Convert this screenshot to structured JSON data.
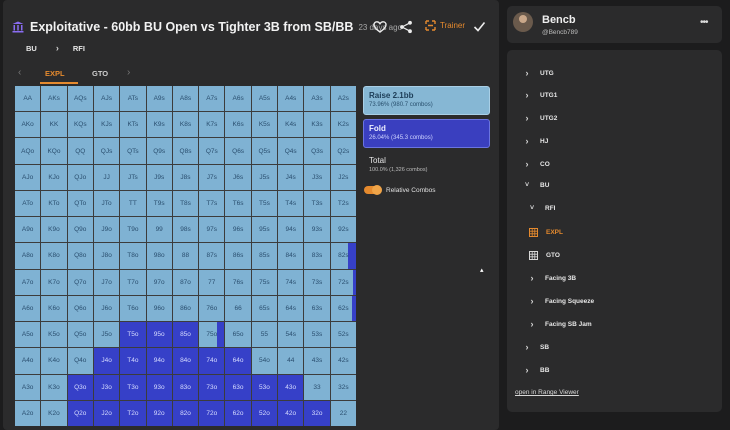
{
  "header": {
    "title": "Exploitative - 60bb BU Open vs Tighter 3B from SB/BB",
    "time_ago": "23 days ago",
    "trainer_label": "Trainer"
  },
  "breadcrumb": {
    "position": "BU",
    "action": "RFI"
  },
  "tabs": [
    {
      "label": "EXPL",
      "active": true
    },
    {
      "label": "GTO",
      "active": false
    }
  ],
  "grid": {
    "hands": [
      [
        "AA",
        "AKs",
        "AQs",
        "AJs",
        "ATs",
        "A9s",
        "A8s",
        "A7s",
        "A6s",
        "A5s",
        "A4s",
        "A3s",
        "A2s"
      ],
      [
        "AKo",
        "KK",
        "KQs",
        "KJs",
        "KTs",
        "K9s",
        "K8s",
        "K7s",
        "K6s",
        "K5s",
        "K4s",
        "K3s",
        "K2s"
      ],
      [
        "AQo",
        "KQo",
        "QQ",
        "QJs",
        "QTs",
        "Q9s",
        "Q8s",
        "Q7s",
        "Q6s",
        "Q5s",
        "Q4s",
        "Q3s",
        "Q2s"
      ],
      [
        "AJo",
        "KJo",
        "QJo",
        "JJ",
        "JTs",
        "J9s",
        "J8s",
        "J7s",
        "J6s",
        "J5s",
        "J4s",
        "J3s",
        "J2s"
      ],
      [
        "ATo",
        "KTo",
        "QTo",
        "JTo",
        "TT",
        "T9s",
        "T8s",
        "T7s",
        "T6s",
        "T5s",
        "T4s",
        "T3s",
        "T2s"
      ],
      [
        "A9o",
        "K9o",
        "Q9o",
        "J9o",
        "T9o",
        "99",
        "98s",
        "97s",
        "96s",
        "95s",
        "94s",
        "93s",
        "92s"
      ],
      [
        "A8o",
        "K8o",
        "Q8o",
        "J8o",
        "T8o",
        "98o",
        "88",
        "87s",
        "86s",
        "85s",
        "84s",
        "83s",
        "82s"
      ],
      [
        "A7o",
        "K7o",
        "Q7o",
        "J7o",
        "T7o",
        "97o",
        "87o",
        "77",
        "76s",
        "75s",
        "74s",
        "73s",
        "72s"
      ],
      [
        "A6o",
        "K6o",
        "Q6o",
        "J6o",
        "T6o",
        "96o",
        "86o",
        "76o",
        "66",
        "65s",
        "64s",
        "63s",
        "62s"
      ],
      [
        "A5o",
        "K5o",
        "Q5o",
        "J5o",
        "T5o",
        "95o",
        "85o",
        "75o",
        "65o",
        "55",
        "54s",
        "53s",
        "52s"
      ],
      [
        "A4o",
        "K4o",
        "Q4o",
        "J4o",
        "T4o",
        "94o",
        "84o",
        "74o",
        "64o",
        "54o",
        "44",
        "43s",
        "42s"
      ],
      [
        "A3o",
        "K3o",
        "Q3o",
        "J3o",
        "T3o",
        "93o",
        "83o",
        "73o",
        "63o",
        "53o",
        "43o",
        "33",
        "32s"
      ],
      [
        "A2o",
        "K2o",
        "Q2o",
        "J2o",
        "T2o",
        "92o",
        "82o",
        "72o",
        "62o",
        "52o",
        "42o",
        "32o",
        "22"
      ]
    ],
    "fold_freq": [
      [
        0,
        0,
        0,
        0,
        0,
        0,
        0,
        0,
        0,
        0,
        0,
        0,
        0
      ],
      [
        0,
        0,
        0,
        0,
        0,
        0,
        0,
        0,
        0,
        0,
        0,
        0,
        0
      ],
      [
        0,
        0,
        0,
        0,
        0,
        0,
        0,
        0,
        0,
        0,
        0,
        0,
        0
      ],
      [
        0,
        0,
        0,
        0,
        0,
        0,
        0,
        0,
        0,
        0,
        0,
        0,
        0
      ],
      [
        0,
        0,
        0,
        0,
        0,
        0,
        0,
        0,
        0,
        0,
        0,
        0,
        0
      ],
      [
        0,
        0,
        0,
        0,
        0,
        0,
        0,
        0,
        0,
        0,
        0,
        0,
        0
      ],
      [
        0,
        0,
        0,
        0,
        0,
        0,
        0,
        0,
        0,
        0,
        0,
        0,
        0.3
      ],
      [
        0,
        0,
        0,
        0,
        0,
        0,
        0,
        0,
        0,
        0,
        0,
        0,
        0.1
      ],
      [
        0,
        0,
        0,
        0,
        0,
        0,
        0,
        0,
        0,
        0,
        0,
        0,
        0.15
      ],
      [
        0,
        0,
        0,
        0,
        1,
        1,
        1,
        0.3,
        0,
        0,
        0,
        0,
        0
      ],
      [
        0,
        0,
        0,
        1,
        1,
        1,
        1,
        1,
        1,
        0,
        0,
        0,
        0
      ],
      [
        0,
        0,
        1,
        1,
        1,
        1,
        1,
        1,
        1,
        1,
        1,
        0,
        0
      ],
      [
        0,
        0,
        1,
        1,
        1,
        1,
        1,
        1,
        1,
        1,
        1,
        1,
        0
      ]
    ]
  },
  "actions": {
    "raise": {
      "name": "Raise 2.1bb",
      "detail": "73.96% (980.7 combos)"
    },
    "fold": {
      "name": "Fold",
      "detail": "26.04% (345.3 combos)"
    },
    "total": {
      "name": "Total",
      "detail": "100.0% (1,326 combos)"
    },
    "relative_combos_label": "Relative Combos"
  },
  "colors": {
    "raise": "#7fb2d3",
    "fold": "#3640c8",
    "accent": "#e58a2e"
  },
  "user": {
    "name": "Bencb",
    "handle": "@Bencb789"
  },
  "nav": {
    "items": [
      {
        "label": "UTG",
        "depth": 0,
        "expanded": false
      },
      {
        "label": "UTG1",
        "depth": 0,
        "expanded": false
      },
      {
        "label": "UTG2",
        "depth": 0,
        "expanded": false
      },
      {
        "label": "HJ",
        "depth": 0,
        "expanded": false
      },
      {
        "label": "CO",
        "depth": 0,
        "expanded": false
      },
      {
        "label": "BU",
        "depth": 0,
        "expanded": true
      },
      {
        "label": "RFI",
        "depth": 1,
        "expanded": true
      },
      {
        "label": "EXPL",
        "depth": 2,
        "icon": "grid-icon",
        "selected": true
      },
      {
        "label": "GTO",
        "depth": 2,
        "icon": "grid-icon",
        "selected": false
      },
      {
        "label": "Facing 3B",
        "depth": 1,
        "expanded": false
      },
      {
        "label": "Facing Squeeze",
        "depth": 1,
        "expanded": false
      },
      {
        "label": "Facing SB Jam",
        "depth": 1,
        "expanded": false
      },
      {
        "label": "SB",
        "depth": 0,
        "expanded": false
      },
      {
        "label": "BB",
        "depth": 0,
        "expanded": false
      }
    ],
    "open_link": "open in Range Viewer"
  }
}
